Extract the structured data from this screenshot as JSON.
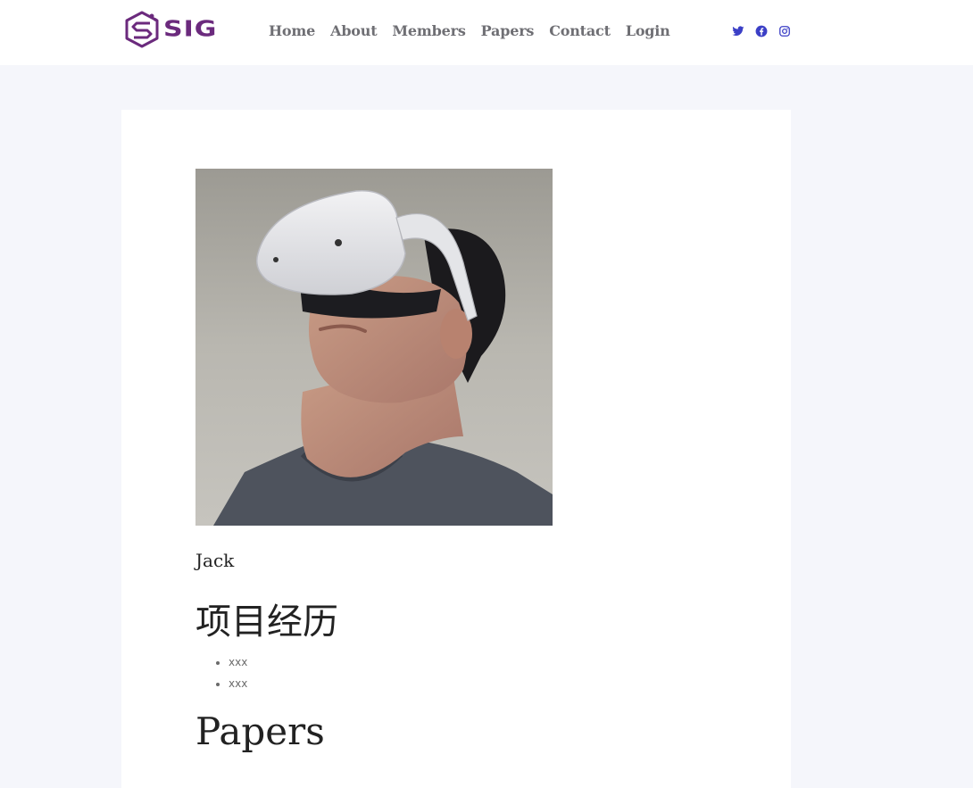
{
  "header": {
    "logo": {
      "text": "SIG",
      "icon": "circuit-s-logo-icon",
      "color": "#6b2a7d"
    },
    "nav": [
      {
        "label": "Home"
      },
      {
        "label": "About"
      },
      {
        "label": "Members"
      },
      {
        "label": "Papers"
      },
      {
        "label": "Contact"
      },
      {
        "label": "Login"
      }
    ],
    "social": [
      {
        "icon": "twitter-icon"
      },
      {
        "icon": "facebook-icon"
      },
      {
        "icon": "instagram-icon"
      }
    ],
    "accent_color": "#3b3fc6"
  },
  "profile": {
    "photo": {
      "icon": "person-vr-headset-photo"
    },
    "name": "Jack",
    "section_title": "项目经历",
    "items": [
      "xxx",
      "xxx"
    ],
    "papers_title": "Papers"
  }
}
